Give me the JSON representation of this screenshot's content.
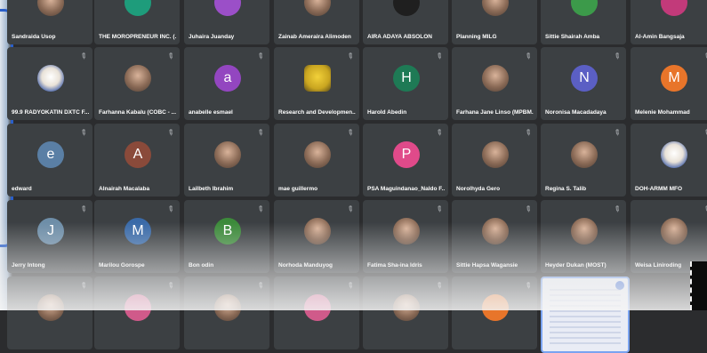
{
  "participants": [
    {
      "name": "Sandraida Usop",
      "kind": "photo",
      "letter": "",
      "color": "#b56b5a"
    },
    {
      "name": "THE MOROPRENEUR INC. (...",
      "kind": "letter",
      "letter": "",
      "color": "#1e9c7b"
    },
    {
      "name": "Juhaira Juanday",
      "kind": "letter",
      "letter": "",
      "color": "#9b4fc8"
    },
    {
      "name": "Zainab Ameraira Alimoden",
      "kind": "photo",
      "letter": "",
      "color": "#7a5a48"
    },
    {
      "name": "AIRA ADAYA ABSOLON",
      "kind": "dark",
      "letter": "",
      "color": "#1f1f1f"
    },
    {
      "name": "Planning MILG",
      "kind": "photo",
      "letter": "",
      "color": "#cfcfcf"
    },
    {
      "name": "Sittie Shairah Amba",
      "kind": "letter",
      "letter": "",
      "color": "#3c9a4a"
    },
    {
      "name": "Al-Amin Bangsaja",
      "kind": "letter",
      "letter": "",
      "color": "#c23a7a"
    },
    {
      "name": "99.9 RADYOKATIN DXTC F...",
      "kind": "logo",
      "letter": "",
      "color": "#3d5ca8"
    },
    {
      "name": "Farhanna Kabalu (COBC - ...",
      "kind": "photo",
      "letter": "",
      "color": "#b07050"
    },
    {
      "name": "anabelle esmael",
      "kind": "letter",
      "letter": "a",
      "color": "#9346c0"
    },
    {
      "name": "Research and Developmen...",
      "kind": "cheer",
      "letter": "",
      "color": "#e2c02a"
    },
    {
      "name": "Harold Abedin",
      "kind": "letter",
      "letter": "H",
      "color": "#1e7a55"
    },
    {
      "name": "Farhana Jane Linso (MPBM...",
      "kind": "photo",
      "letter": "",
      "color": "#3a2a22"
    },
    {
      "name": "Noronisa Macadadaya",
      "kind": "letter",
      "letter": "N",
      "color": "#5b5fc4"
    },
    {
      "name": "Melenie Mohammad",
      "kind": "letter",
      "letter": "M",
      "color": "#e8752a"
    },
    {
      "name": "edward",
      "kind": "letter",
      "letter": "e",
      "color": "#5a7fa5"
    },
    {
      "name": "Alnairah Macalaba",
      "kind": "letter",
      "letter": "A",
      "color": "#8a4a3a"
    },
    {
      "name": "Lailbeth Ibrahim",
      "kind": "photo",
      "letter": "",
      "color": "#4aa6a6"
    },
    {
      "name": "mae guillermo",
      "kind": "photo",
      "letter": "",
      "color": "#b04a5a"
    },
    {
      "name": "PSA Maguindanao_Naldo F...",
      "kind": "letter",
      "letter": "P",
      "color": "#e04a8a"
    },
    {
      "name": "Norolhyda Gero",
      "kind": "photo",
      "letter": "",
      "color": "#6a6a4a"
    },
    {
      "name": "Regina S. Talib",
      "kind": "photo",
      "letter": "",
      "color": "#d09070"
    },
    {
      "name": "DOH-ARMM MFO",
      "kind": "logo",
      "letter": "",
      "color": "#3d5ca8"
    },
    {
      "name": "Jerry Intong",
      "kind": "letter",
      "letter": "J",
      "color": "#6e8ea8"
    },
    {
      "name": "Marilou Gorospe",
      "kind": "letter",
      "letter": "M",
      "color": "#3a6aa8"
    },
    {
      "name": "Bon odin",
      "kind": "letter",
      "letter": "B",
      "color": "#3c8a3a"
    },
    {
      "name": "Norhoda Manduyog",
      "kind": "photo",
      "letter": "",
      "color": "#a88a6a"
    },
    {
      "name": "Fatima Sha-ina Idris",
      "kind": "photo",
      "letter": "",
      "color": "#c08a6a"
    },
    {
      "name": "Sittie Hapsa Wagansie",
      "kind": "photo",
      "letter": "",
      "color": "#d8d8d8"
    },
    {
      "name": "Heyder Dukan (MOST)",
      "kind": "photo",
      "letter": "",
      "color": "#6a7ab0"
    },
    {
      "name": "Weisa Liniroding",
      "kind": "photo",
      "letter": "",
      "color": "#9a8a7a"
    },
    {
      "name": "",
      "kind": "photo",
      "letter": "",
      "color": "#a88a6a"
    },
    {
      "name": "",
      "kind": "letter",
      "letter": "",
      "color": "#d05a8a"
    },
    {
      "name": "",
      "kind": "photo",
      "letter": "",
      "color": "#9a7a5a"
    },
    {
      "name": "",
      "kind": "letter",
      "letter": "",
      "color": "#d05a8a"
    },
    {
      "name": "",
      "kind": "photo",
      "letter": "",
      "color": "#b08a6a"
    },
    {
      "name": "",
      "kind": "letter",
      "letter": "",
      "color": "#e8752a"
    },
    {
      "name": "",
      "kind": "shared",
      "letter": "",
      "color": "#4a76d8"
    },
    {
      "name": "",
      "kind": "empty",
      "letter": "",
      "color": ""
    }
  ]
}
